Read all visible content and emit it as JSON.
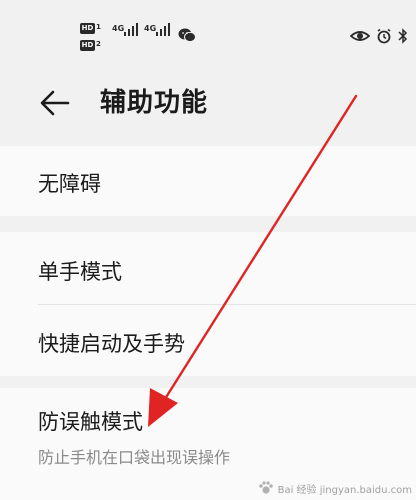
{
  "status_bar": {
    "sim1": {
      "badge": "HD",
      "slot": "1",
      "network": "4G"
    },
    "sim2": {
      "badge": "HD",
      "slot": "2",
      "network": "4G"
    },
    "network2": "4G",
    "left_icons": [
      "hd-badge",
      "signal-icon",
      "wechat-icon"
    ],
    "right_icons": [
      "eye-comfort-icon",
      "alarm-icon",
      "bluetooth-icon"
    ]
  },
  "header": {
    "title": "辅助功能",
    "back_icon": "back-arrow-icon"
  },
  "items": [
    {
      "label": "无障碍"
    },
    {
      "label": "单手模式"
    },
    {
      "label": "快捷启动及手势"
    },
    {
      "label": "防误触模式",
      "subtitle": "防止手机在口袋出现误操作"
    }
  ],
  "annotation": {
    "type": "red-arrow",
    "color": "#e02424",
    "points_to": "防误触模式"
  },
  "watermark": {
    "text": "Bai 经验 jingyan.baidu.com"
  },
  "colors": {
    "background": "#f1f1f1",
    "card": "#fafafa",
    "text": "#1b1b1b",
    "subtext": "#8a8a8a",
    "arrow": "#e02424"
  }
}
